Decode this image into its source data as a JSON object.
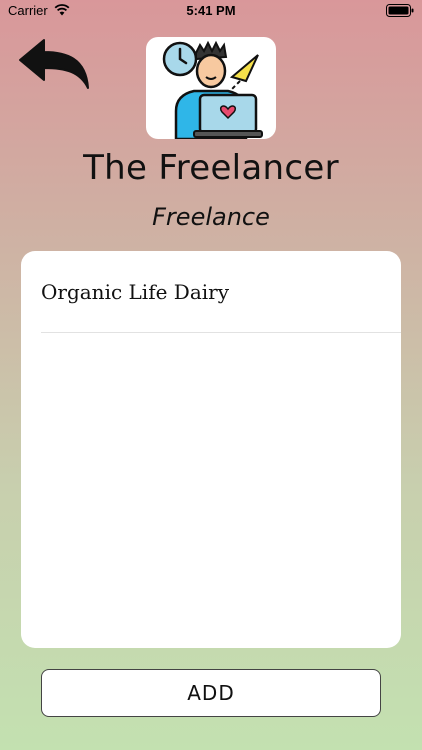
{
  "status_bar": {
    "carrier": "Carrier",
    "time": "5:41 PM"
  },
  "header": {
    "back_icon": "back-arrow-icon",
    "avatar_icon": "freelancer-illustration"
  },
  "profile": {
    "name": "The Freelancer",
    "category": "Freelance"
  },
  "list": {
    "items": [
      {
        "label": "Organic Life Dairy"
      }
    ]
  },
  "actions": {
    "add_label": "ADD"
  }
}
